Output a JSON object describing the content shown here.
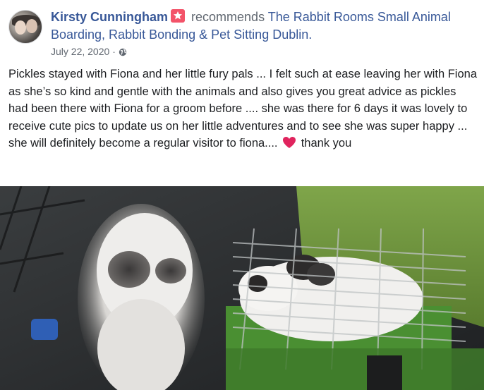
{
  "post": {
    "author_name": "Kirsty Cunningham",
    "recommends_text": "recommends",
    "page_name": "The Rabbit Rooms Small Animal Boarding, Rabbit Bonding & Pet Sitting Dublin.",
    "date": "July 22, 2020",
    "separator": "·",
    "privacy_icon": "globe-icon",
    "badge_icon": "recommendation-star-icon",
    "body_text": "Pickles stayed with Fiona and her little fury pals ... I felt such at ease leaving her with Fiona as she’s so kind and gentle with the animals and also gives you great advice as pickles had been there with Fiona for a groom before .... she was there for 6 days it was lovely to receive cute pics to update us on her little adventures and to see she was super happy ... she will definitely become a regular visitor to fiona....",
    "heart_icon": "red-heart-emoji-icon",
    "body_text_end": "thank you"
  },
  "colors": {
    "link": "#385898",
    "meta": "#606770",
    "text": "#1c1e21",
    "badge": "#f35369",
    "heart": "#e0245e"
  }
}
